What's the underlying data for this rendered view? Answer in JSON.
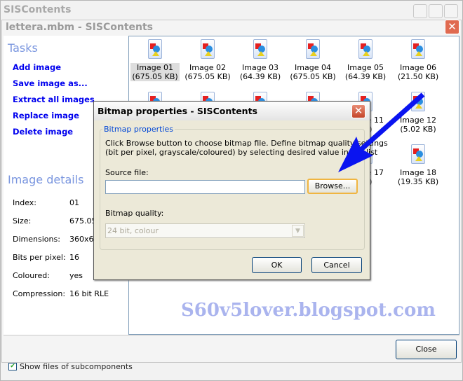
{
  "outer_window": {
    "title": "SISContents"
  },
  "window": {
    "title": "lettera.mbm - SISContents",
    "close_icon": "close-icon"
  },
  "tasks": {
    "heading": "Tasks",
    "items": [
      "Add image",
      "Save image as...",
      "Extract all images",
      "Replace image",
      "Delete image"
    ]
  },
  "details": {
    "heading": "Image details",
    "rows": [
      {
        "k": "Index:",
        "v": "01"
      },
      {
        "k": "Size:",
        "v": "675.05"
      },
      {
        "k": "Dimensions:",
        "v": "360x64"
      },
      {
        "k": "Bits per pixel:",
        "v": "16"
      },
      {
        "k": "Coloured:",
        "v": "yes"
      },
      {
        "k": "Compression:",
        "v": "16 bit RLE"
      }
    ]
  },
  "images": [
    {
      "label": "Image 01",
      "size": "(675.05 KB)",
      "selected": true
    },
    {
      "label": "Image 02",
      "size": "(675.05 KB)"
    },
    {
      "label": "Image 03",
      "size": "(64.39 KB)"
    },
    {
      "label": "Image 04",
      "size": "(675.05 KB)"
    },
    {
      "label": "Image 05",
      "size": "(64.39 KB)"
    },
    {
      "label": "Image 06",
      "size": "(21.50 KB)"
    },
    {},
    {},
    {},
    {},
    {
      "label": "Image 11",
      "size": "KB)"
    },
    {
      "label": "Image 12",
      "size": "(5.02 KB)"
    },
    {},
    {},
    {},
    {},
    {
      "label": "Image 17",
      "size": "KB)"
    },
    {
      "label": "Image 18",
      "size": "(19.35 KB)"
    }
  ],
  "footer": {
    "close_label": "Close",
    "checkbox_label": "Show files of subcomponents",
    "checkbox_checked": true
  },
  "dialog": {
    "title": "Bitmap properties - SISContents",
    "group_label": "Bitmap properties",
    "desc_line1": "Click Browse button to choose bitmap file. Define bitmap quality settings",
    "desc_line2": "(bit per pixel, grayscale/coloured) by selecting desired value in the list",
    "source_label": "Source file:",
    "source_value": "",
    "browse_label": "Browse...",
    "quality_label": "Bitmap quality:",
    "quality_value": "24 bit, colour",
    "ok_label": "OK",
    "cancel_label": "Cancel"
  },
  "watermark": "S60v5lover.blogspot.com",
  "colors": {
    "link": "#0000ee",
    "heading": "#7a96df",
    "arrow": "#0a14f0",
    "watermark": "#aab4ee"
  }
}
